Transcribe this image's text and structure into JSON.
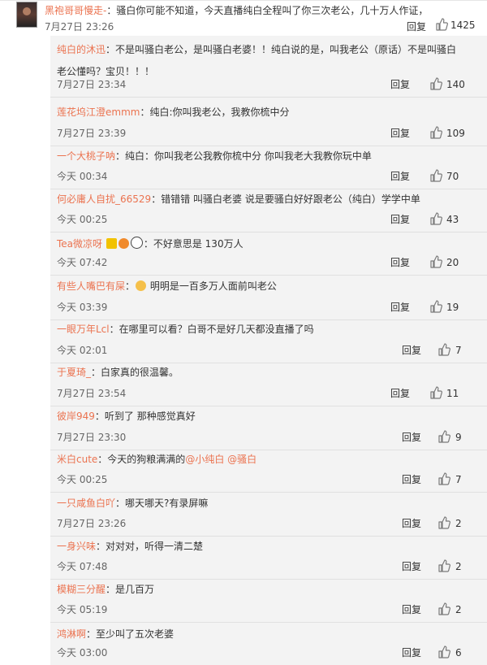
{
  "main_comment": {
    "username": "黑袍哥哥慢走-",
    "text": "：骚白你可能不知道，今天直播纯白全程叫了你三次老公，几十万人作证，",
    "time": "7月27日 23:26",
    "reply_label": "回复",
    "likes": "1425"
  },
  "replies": [
    {
      "user": "纯白的沐迅",
      "text_before": "：不是叫骚白老公，是叫骚白老婆！！纯白说的是，叫我老公（原话）不是叫骚白",
      "text_line2": "老公懂吗？宝贝！！！",
      "time": "7月27日 23:34",
      "reply": "回复",
      "likes": "140"
    },
    {
      "user": "莲花坞江澄emmm",
      "text": "：纯白:你叫我老公，我教你梳中分",
      "time": "7月27日 23:39",
      "reply": "回复",
      "likes": "109"
    },
    {
      "user": "一个大桃子呐",
      "text": "：纯白：你叫我老公我教你梳中分   你叫我老大我教你玩中单",
      "time": "今天 00:34",
      "reply": "回复",
      "likes": "70"
    },
    {
      "user": "何必庸人自扰_66529",
      "text": "：错错错 叫骚白老婆 说是要骚白好好跟老公（纯白）学学中单",
      "time": "今天 00:25",
      "reply": "回复",
      "likes": "43"
    },
    {
      "user": "Tea微凉呀",
      "text": "：不好意思是   130万人",
      "time": "今天 07:42",
      "reply": "回复",
      "likes": "20"
    },
    {
      "user": "有些人嘴巴有屎",
      "text": "明明是一百多万人面前叫老公",
      "time": "今天 03:39",
      "reply": "回复",
      "likes": "19"
    },
    {
      "user": "一眼万年Lcl",
      "text": "：在哪里可以看？白哥不是好几天都没直播了吗",
      "time": "今天 02:01",
      "reply": "回复",
      "likes": "7"
    },
    {
      "user": "于夏琦_",
      "text": "：白家真的很温馨。",
      "time": "7月27日 23:54",
      "reply": "回复",
      "likes": "11"
    },
    {
      "user": "彼岸949",
      "text": "：听到了  那种感觉真好",
      "time": "7月27日 23:30",
      "reply": "回复",
      "likes": "9"
    },
    {
      "user": "米白cute",
      "text": "：今天的狗粮满满的",
      "mention1": "@小纯白",
      "mention2": "@骚白",
      "time": "今天 00:25",
      "reply": "回复",
      "likes": "7"
    },
    {
      "user": "一只咸鱼白吖",
      "text": "：哪天哪天?有录屏嘛",
      "time": "7月27日 23:26",
      "reply": "回复",
      "likes": "2"
    },
    {
      "user": "一身兴味",
      "text": "：对对对，听得一清二楚",
      "time": "今天 07:48",
      "reply": "回复",
      "likes": "2"
    },
    {
      "user": "模糊三分醒",
      "text": "：是几百万",
      "time": "今天 05:19",
      "reply": "回复",
      "likes": "2"
    },
    {
      "user": "鸿淋啊",
      "text": "：至少叫了五次老婆",
      "time": "今天 03:00",
      "reply": "回复",
      "likes": "6"
    }
  ],
  "colors": {
    "username": "#eb7350",
    "background": "#f3f3f3",
    "icon": "#7a7a7a"
  },
  "icons": {
    "like": "thumb-up-icon",
    "avatar": "avatar"
  }
}
